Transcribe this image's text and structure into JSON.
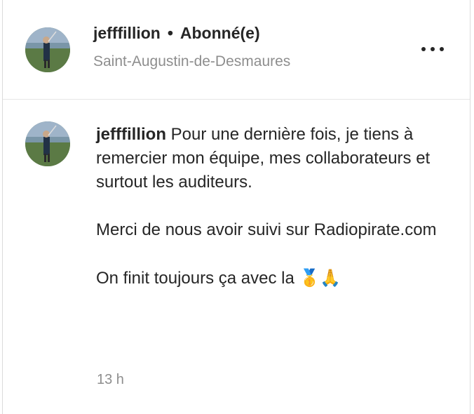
{
  "post_header": {
    "username": "jefffillion",
    "separator": "•",
    "follow_status": "Abonné(e)",
    "location": "Saint-Augustin-de-Desmaures"
  },
  "caption": {
    "username": "jefffillion",
    "paragraphs": [
      "Pour une dernière fois, je tiens à remercier mon équipe, mes collaborateurs et surtout les auditeurs.",
      "Merci de nous avoir suivi sur Radiopirate.com",
      "On finit toujours ça avec la"
    ],
    "emojis": "🥇🙏",
    "timestamp": "13 h"
  },
  "icons": {
    "more": "more-options-icon",
    "avatar": "profile-picture"
  }
}
